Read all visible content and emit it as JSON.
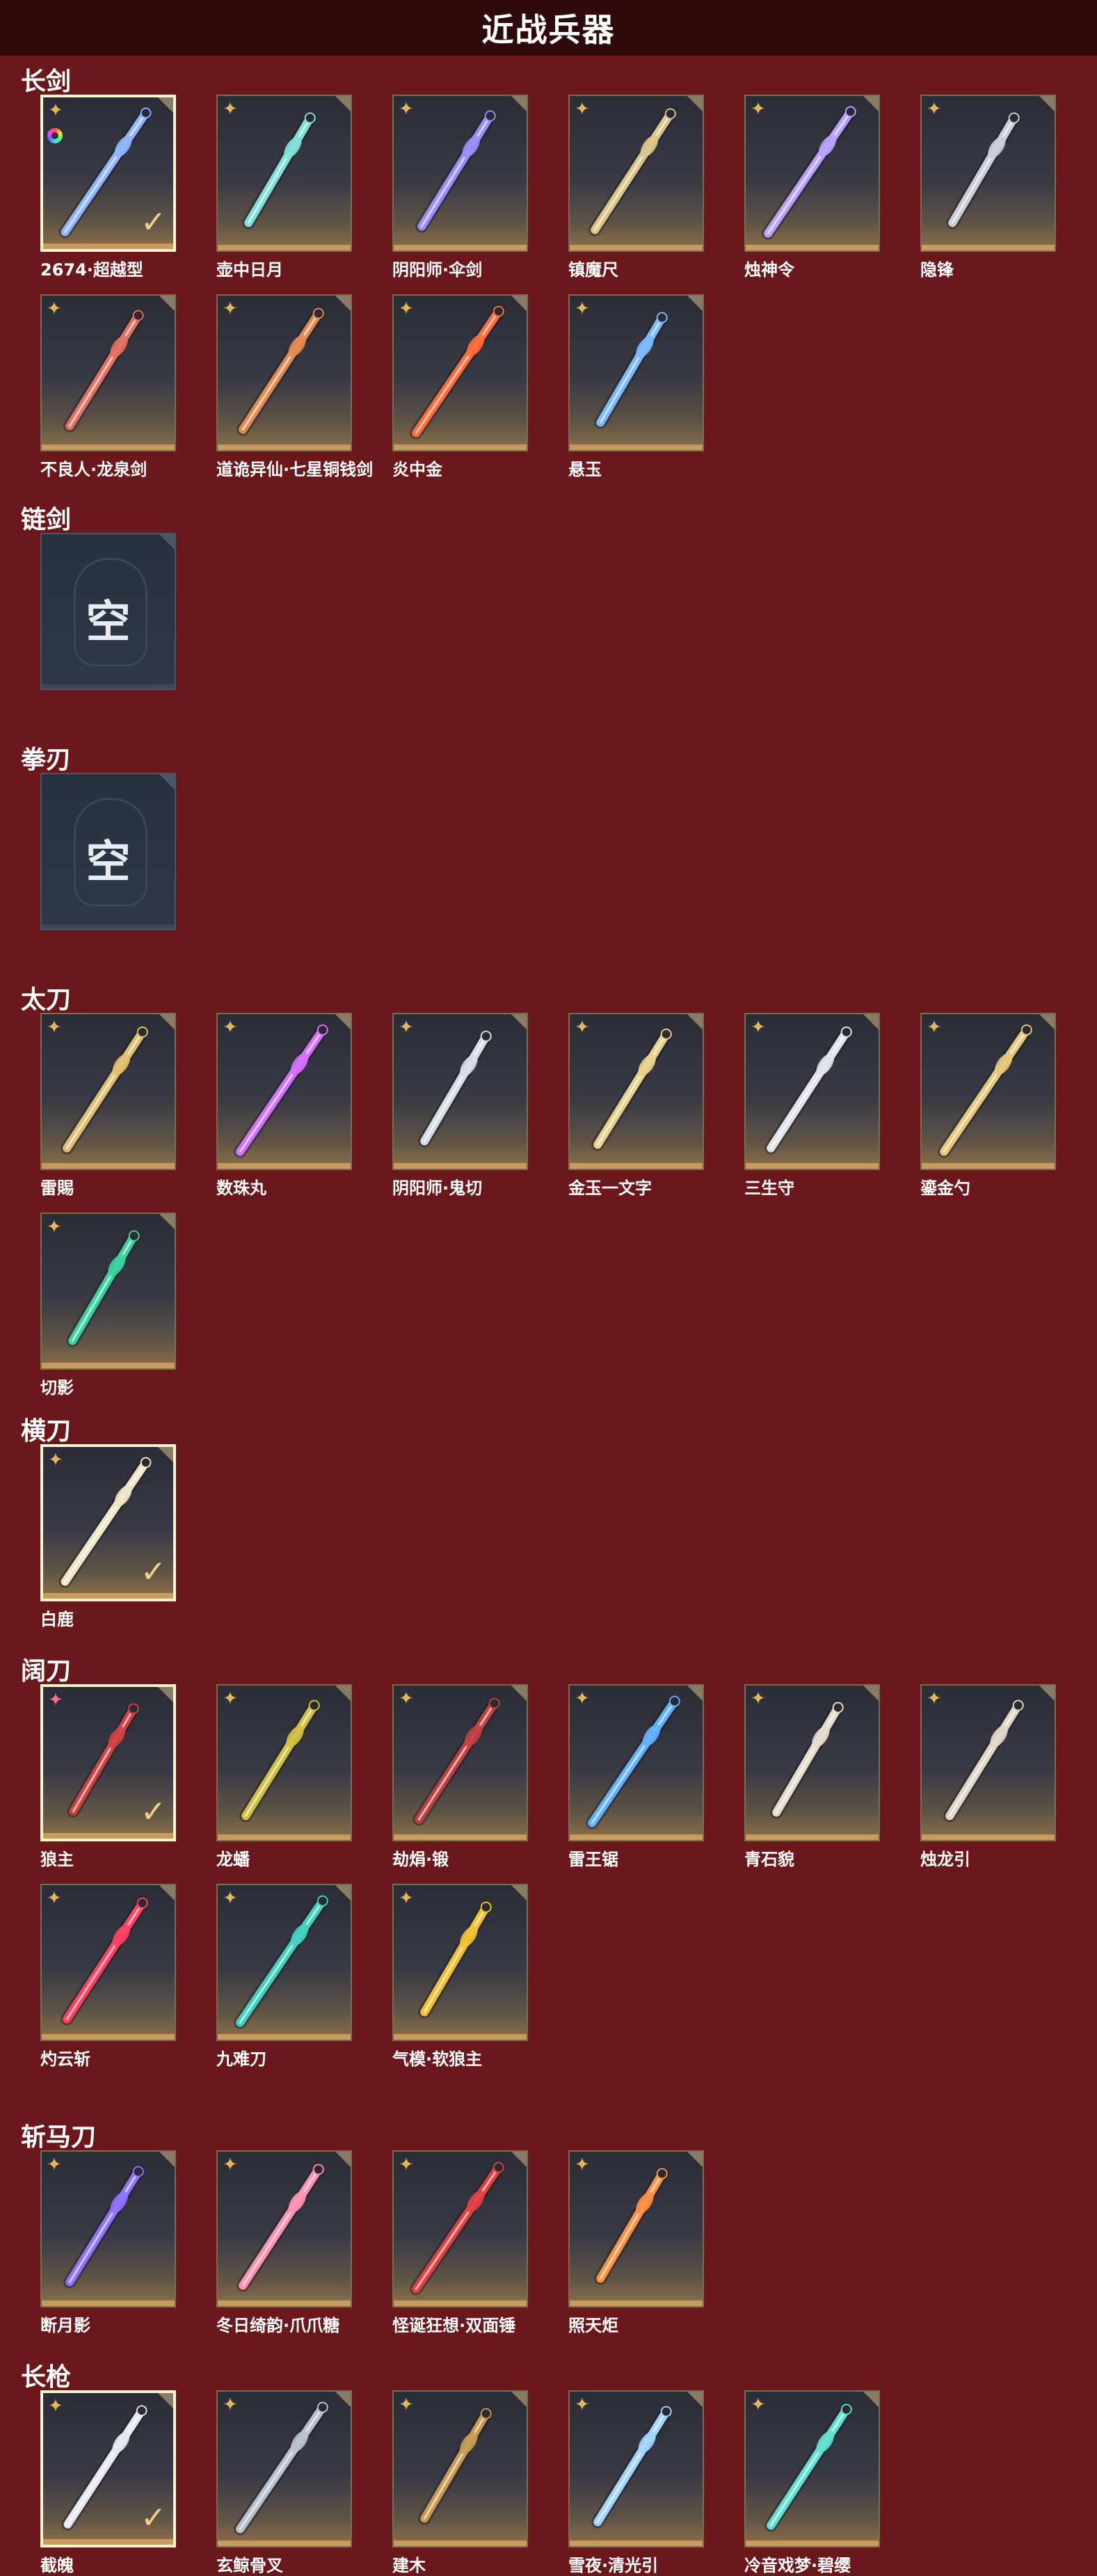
{
  "page": {
    "title": "近战兵器"
  },
  "sections": [
    {
      "title": "长剑",
      "items": [
        {
          "name": "2674·超越型",
          "selected": true,
          "badge": "rainbow",
          "icon": "laser-sword-icon",
          "color": "#8fb4ff"
        },
        {
          "name": "壶中日月",
          "icon": "jade-sword-icon",
          "color": "#7fe0d8"
        },
        {
          "name": "阴阳师·伞剑",
          "icon": "umbrella-sword-icon",
          "color": "#9a8cff"
        },
        {
          "name": "镇魔尺",
          "icon": "ruler-sword-icon",
          "color": "#d9c58a"
        },
        {
          "name": "烛神令",
          "icon": "violet-sword-icon",
          "color": "#b9a0ff"
        },
        {
          "name": "隐锋",
          "icon": "slim-sword-icon",
          "color": "#c9cdd8"
        },
        {
          "name": "不良人·龙泉剑",
          "icon": "dragon-spring-sword-icon",
          "color": "#e07060"
        },
        {
          "name": "道诡异仙·七星铜钱剑",
          "icon": "coin-sword-icon",
          "color": "#e08a50"
        },
        {
          "name": "炎中金",
          "icon": "flame-sword-icon",
          "color": "#ff6a3a"
        },
        {
          "name": "悬玉",
          "icon": "ice-sword-icon",
          "color": "#7ab8ff"
        }
      ]
    },
    {
      "title": "链剑",
      "items": [
        {
          "name": "",
          "empty": true,
          "empty_text": "空"
        }
      ]
    },
    {
      "title": "拳刃",
      "items": [
        {
          "name": "",
          "empty": true,
          "empty_text": "空"
        }
      ]
    },
    {
      "title": "太刀",
      "items": [
        {
          "name": "雷賜",
          "icon": "gold-tachi-icon",
          "color": "#e0c070"
        },
        {
          "name": "数珠丸",
          "icon": "purple-tachi-icon",
          "color": "#d070ff"
        },
        {
          "name": "阴阳师·鬼切",
          "icon": "twin-tachi-icon",
          "color": "#d8dce6"
        },
        {
          "name": "金玉一文字",
          "icon": "jade-tachi-icon",
          "color": "#e6d28a"
        },
        {
          "name": "三生守",
          "icon": "silver-tachi-icon",
          "color": "#e2e2ea"
        },
        {
          "name": "鎏金勺",
          "icon": "golden-spoon-icon",
          "color": "#e6c878"
        },
        {
          "name": "切影",
          "icon": "shadow-tachi-icon",
          "color": "#3ad0a0"
        }
      ]
    },
    {
      "title": "横刀",
      "items": [
        {
          "name": "白鹿",
          "selected": true,
          "icon": "white-deer-blade-icon",
          "color": "#efe6c6"
        }
      ]
    },
    {
      "title": "阔刀",
      "items": [
        {
          "name": "狼主",
          "selected": true,
          "star": "pink",
          "icon": "wolf-glaive-icon",
          "color": "#d04040"
        },
        {
          "name": "龙蟠",
          "icon": "dragon-glaive-icon",
          "color": "#d0c040"
        },
        {
          "name": "劫焆·锻",
          "icon": "dark-glaive-icon",
          "color": "#c04040"
        },
        {
          "name": "雷王锯",
          "icon": "thunder-saw-icon",
          "color": "#60b0ff"
        },
        {
          "name": "青石貌",
          "icon": "stone-glaive-icon",
          "color": "#e6dccc"
        },
        {
          "name": "烛龙引",
          "icon": "candle-dragon-glaive-icon",
          "color": "#e0d6c8"
        },
        {
          "name": "灼云斩",
          "icon": "crimson-glaive-icon",
          "color": "#ff4060"
        },
        {
          "name": "九难刀",
          "icon": "teal-glaive-icon",
          "color": "#40d0c0"
        },
        {
          "name": "气模·软狼主",
          "icon": "yellow-glaive-icon",
          "color": "#f0c030"
        }
      ]
    },
    {
      "title": "斩马刀",
      "items": [
        {
          "name": "断月影",
          "icon": "moon-blade-icon",
          "color": "#9070ff"
        },
        {
          "name": "冬日绮韵·爪爪糖",
          "icon": "paw-candy-icon",
          "color": "#ff90b0"
        },
        {
          "name": "怪诞狂想·双面锤",
          "icon": "clown-hammer-icon",
          "color": "#e04040"
        },
        {
          "name": "照天炬",
          "icon": "torch-blade-icon",
          "color": "#ff9040"
        }
      ]
    },
    {
      "title": "长枪",
      "items": [
        {
          "name": "截魄",
          "selected": true,
          "icon": "silver-spear-icon",
          "color": "#e6e8ee"
        },
        {
          "name": "玄鲸骨叉",
          "icon": "whale-trident-icon",
          "color": "#b8c0cc"
        },
        {
          "name": "建木",
          "icon": "wood-spear-icon",
          "color": "#c89a50"
        },
        {
          "name": "雪夜·清光引",
          "icon": "snow-spear-icon",
          "color": "#a0d4ff"
        },
        {
          "name": "冷音戏梦·碧缨",
          "icon": "jade-tassel-spear-icon",
          "color": "#60e0d0"
        }
      ]
    }
  ]
}
